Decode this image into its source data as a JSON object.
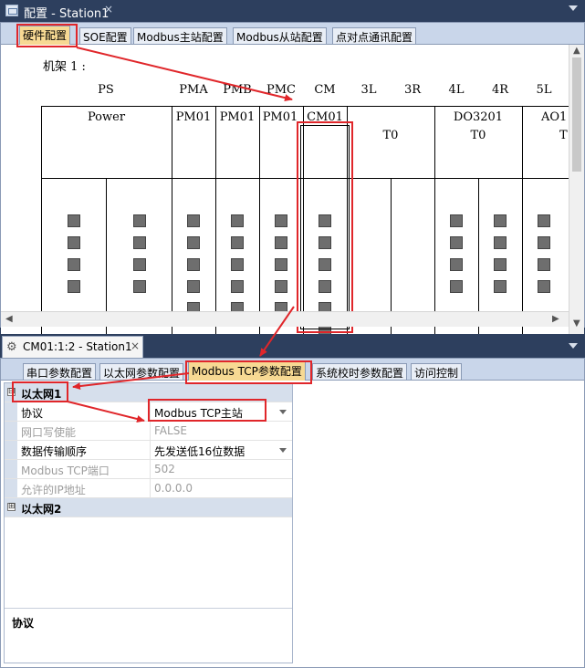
{
  "top_window": {
    "title": "配置 - Station1",
    "close_glyph": "×",
    "tabs": [
      "硬件配置",
      "SOE配置",
      "Modbus主站配置",
      "Modbus从站配置",
      "点对点通讯配置"
    ],
    "active_tab": "硬件配置"
  },
  "rack": {
    "title": "机架 1 :",
    "slots": [
      "PS",
      "PMA",
      "PMB",
      "PMC",
      "CM",
      "3L",
      "3R",
      "4L",
      "4R",
      "5L"
    ],
    "modules": {
      "power": "Power",
      "pma": "PM01",
      "pmb": "PM01",
      "pmc": "PM01",
      "cm": "CM01",
      "t0_a": "T0",
      "do_name": "DO3201",
      "t0_b": "T0",
      "ao_name": "AO1",
      "t0_c": "T"
    }
  },
  "bottom_window": {
    "doc_tab": "CM01:1:2 - Station1",
    "close_glyph": "×",
    "tabs": [
      "串口参数配置",
      "以太网参数配置",
      "Modbus TCP参数配置",
      "系统校时参数配置",
      "访问控制"
    ],
    "active_tab": "Modbus TCP参数配置"
  },
  "property_grid": {
    "cat1": "以太网1",
    "cat2": "以太网2",
    "expand_glyph": "⊟",
    "collapse_glyph": "⊞",
    "rows": [
      {
        "name": "协议",
        "value": "Modbus TCP主站",
        "enabled": true,
        "dropdown": true
      },
      {
        "name": "网口写使能",
        "value": "FALSE",
        "enabled": false,
        "dropdown": false
      },
      {
        "name": "数据传输顺序",
        "value": "先发送低16位数据",
        "enabled": true,
        "dropdown": true
      },
      {
        "name": "Modbus TCP端口",
        "value": "502",
        "enabled": false,
        "dropdown": false
      },
      {
        "name": "允许的IP地址",
        "value": "0.0.0.0",
        "enabled": false,
        "dropdown": false
      }
    ],
    "description_title": "协议"
  },
  "colors": {
    "highlight": "#e0262a",
    "active_tab": "#f7d993",
    "category_bg": "#d6dfec"
  }
}
